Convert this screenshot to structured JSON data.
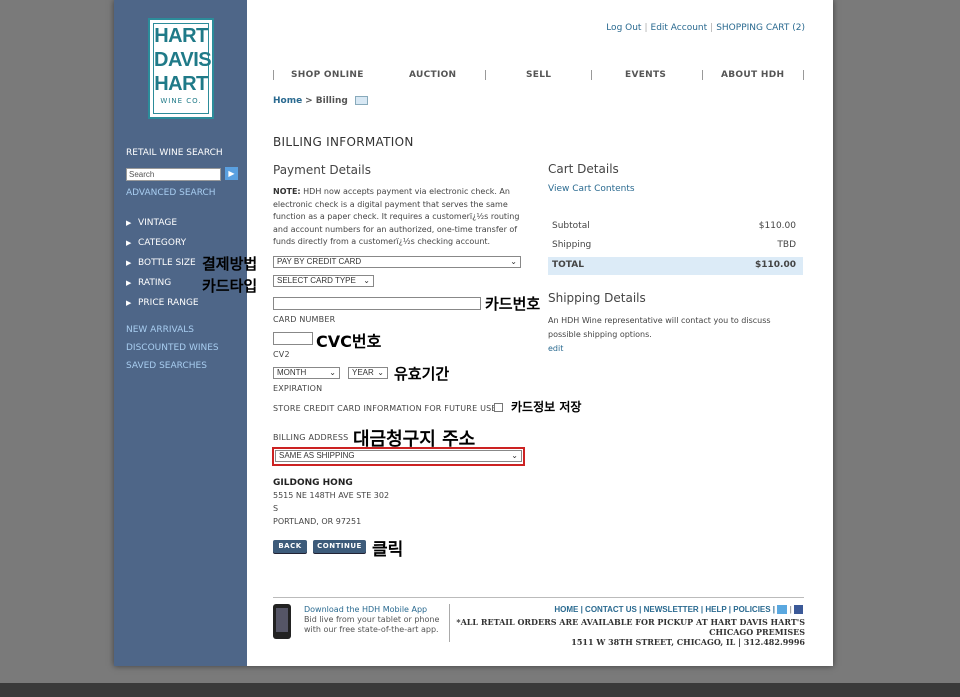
{
  "logo": {
    "line1": "HART",
    "line2": "DAVIS",
    "line3": "HART",
    "sub": "WINE CO."
  },
  "sidebar": {
    "search_title": "RETAIL WINE SEARCH",
    "search_placeholder": "Search",
    "go_glyph": "▶",
    "advanced": "ADVANCED SEARCH",
    "filters": [
      "VINTAGE",
      "CATEGORY",
      "BOTTLE SIZE",
      "RATING",
      "PRICE RANGE"
    ],
    "links": [
      "NEW ARRIVALS",
      "DISCOUNTED WINES",
      "SAVED SEARCHES"
    ]
  },
  "header": {
    "logout": "Log Out",
    "edit_account": "Edit Account",
    "cart": "SHOPPING CART (2)",
    "nav": [
      "SHOP ONLINE",
      "AUCTION",
      "SELL",
      "EVENTS",
      "ABOUT HDH"
    ]
  },
  "breadcrumb": {
    "home": "Home",
    "current": "> Billing"
  },
  "billing": {
    "title": "BILLING INFORMATION",
    "payment_heading": "Payment Details",
    "note_label": "NOTE:",
    "note_text": " HDH now accepts payment via electronic check. An electronic check is a digital payment that serves the same function as a paper check. It requires a customerï¿½s routing and account numbers for an authorized, one-time transfer of funds directly from a customerï¿½s checking account.",
    "payment_method": "PAY BY CREDIT CARD",
    "card_type": "SELECT CARD TYPE",
    "card_number_label": "CARD NUMBER",
    "cvv_label": "CV2",
    "month": "MONTH",
    "year": "YEAR",
    "expiration_label": "EXPIRATION",
    "store_label": "STORE CREDIT CARD INFORMATION FOR FUTURE USE",
    "billing_address_label": "BILLING ADDRESS",
    "billing_address_select": "SAME AS SHIPPING",
    "name": "GILDONG HONG",
    "addr1": "5515 NE 148TH AVE STE 302",
    "addr2": "S",
    "addr3": "PORTLAND, OR 97251",
    "back": "BACK",
    "continue": "CONTINUE"
  },
  "cart": {
    "heading": "Cart Details",
    "view_link": "View Cart Contents",
    "subtotal_label": "Subtotal",
    "subtotal_value": "$110.00",
    "shipping_label": "Shipping",
    "shipping_value": "TBD",
    "total_label": "TOTAL",
    "total_value": "$110.00"
  },
  "shipping": {
    "heading": "Shipping Details",
    "text1": "An HDH Wine representative will contact you to discuss",
    "text2": "possible shipping options.",
    "edit": "edit"
  },
  "annotations": {
    "payment_method": "결제방법",
    "card_type": "카드타입",
    "card_number": "카드번호",
    "cvc": "CVC번호",
    "expiry": "유효기간",
    "save_card": "카드정보 저장",
    "billing_address": "대금청구지 주소",
    "click": "클릭"
  },
  "footer": {
    "app_title": "Download the HDH Mobile App",
    "app_line2": "Bid live from your tablet or phone",
    "app_line3": "with our free state-of-the-art app.",
    "links": "HOME | CONTACT US | NEWSLETTER | HELP | POLICIES |",
    "notice1": "*ALL RETAIL ORDERS ARE AVAILABLE FOR PICKUP AT HART DAVIS HART'S",
    "notice2": "CHICAGO PREMISES",
    "notice3": "1511 W 38TH STREET, CHICAGO, IL | 312.482.9996"
  },
  "colors": {
    "sidebar": "#4e6688",
    "accent": "#2a6a90",
    "highlight": "#cc2222",
    "total_bg": "#dcebf7"
  }
}
